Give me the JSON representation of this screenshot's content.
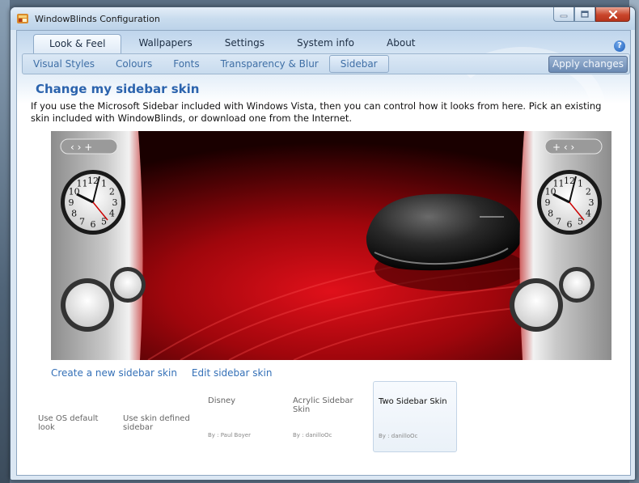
{
  "window": {
    "title": "WindowBlinds Configuration"
  },
  "main_tabs": [
    {
      "label": "Look & Feel",
      "active": true
    },
    {
      "label": "Wallpapers",
      "active": false
    },
    {
      "label": "Settings",
      "active": false
    },
    {
      "label": "System info",
      "active": false
    },
    {
      "label": "About",
      "active": false
    }
  ],
  "help": {
    "glyph": "?"
  },
  "sub_tabs": [
    {
      "label": "Visual Styles",
      "active": false
    },
    {
      "label": "Colours",
      "active": false
    },
    {
      "label": "Fonts",
      "active": false
    },
    {
      "label": "Transparency & Blur",
      "active": false
    },
    {
      "label": "Sidebar",
      "active": true
    }
  ],
  "apply_label": "Apply changes",
  "page": {
    "title": "Change my sidebar skin",
    "description": "If you use the Microsoft Sidebar included with Windows Vista, then you can control how it looks from here.  Pick an existing skin included with WindowBlinds, or download one from the Internet."
  },
  "preview": {
    "clock_numerals": [
      "12",
      "1",
      "2",
      "3",
      "4",
      "5",
      "6",
      "7",
      "8",
      "9",
      "10",
      "11"
    ]
  },
  "links": {
    "create": "Create a new sidebar skin",
    "edit": "Edit sidebar skin"
  },
  "skins": [
    {
      "name": "Use OS default look",
      "author": "",
      "selected": false
    },
    {
      "name": "Use skin defined sidebar",
      "author": "",
      "selected": false
    },
    {
      "name": "Disney",
      "author": "By : Paul Boyer",
      "selected": false
    },
    {
      "name": "Acrylic Sidebar Skin",
      "author": "By : danilloOc",
      "selected": false
    },
    {
      "name": "Two Sidebar Skin",
      "author": "By : danilloOc",
      "selected": true
    }
  ],
  "colors": {
    "accent": "#2b63ad",
    "link": "#3470b7",
    "close_button": "#c9452b"
  }
}
